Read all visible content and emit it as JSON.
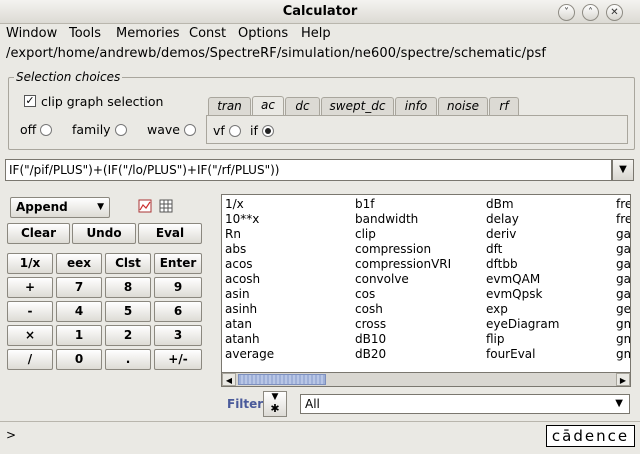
{
  "window": {
    "title": "Calculator",
    "min_glyph": "˅",
    "max_glyph": "˄",
    "close_glyph": "✕"
  },
  "menu": [
    "Window",
    "Tools",
    "Memories",
    "Const",
    "Options",
    "Help"
  ],
  "path": "/export/home/andrewb/demos/SpectreRF/simulation/ne600/spectre/schematic/psf",
  "selection": {
    "legend": "Selection choices",
    "clip_label": "clip graph selection",
    "clip_checked": true,
    "off_label": "off",
    "family_label": "family",
    "wave_label": "wave",
    "tabs": [
      "tran",
      "ac",
      "dc",
      "swept_dc",
      "info",
      "noise",
      "rf"
    ],
    "active_tab": "ac",
    "vf_label": "vf",
    "if_label": "if"
  },
  "expression": "IF(\"/pif/PLUS\")+(IF(\"/lo/PLUS\")+IF(\"/rf/PLUS\"))",
  "controls": {
    "append_label": "Append",
    "clear_label": "Clear",
    "undo_label": "Undo",
    "eval_label": "Eval"
  },
  "keypad": [
    [
      "1/x",
      "eex",
      "Clst",
      "Enter"
    ],
    [
      "+",
      "7",
      "8",
      "9"
    ],
    [
      "-",
      "4",
      "5",
      "6"
    ],
    [
      "×",
      "1",
      "2",
      "3"
    ],
    [
      "/",
      "0",
      ".",
      "+/-"
    ]
  ],
  "functions": {
    "col1": [
      "1/x",
      "10**x",
      "Rn",
      "abs",
      "acos",
      "acosh",
      "asin",
      "asinh",
      "atan",
      "atanh",
      "average"
    ],
    "col2": [
      "b1f",
      "bandwidth",
      "clip",
      "compression",
      "compressionVRI",
      "convolve",
      "cos",
      "cosh",
      "cross",
      "dB10",
      "dB20"
    ],
    "col3": [
      "dBm",
      "delay",
      "deriv",
      "dft",
      "dftbb",
      "evmQAM",
      "evmQpsk",
      "exp",
      "eyeDiagram",
      "flip",
      "fourEval"
    ],
    "col4": [
      "fre",
      "fre",
      "ga",
      "ga",
      "ga",
      "ga",
      "ga",
      "ge",
      "gm",
      "gm",
      "gm"
    ]
  },
  "filter": {
    "label": "Filter",
    "value": "All"
  },
  "prompt": ">",
  "logo": "cādence"
}
